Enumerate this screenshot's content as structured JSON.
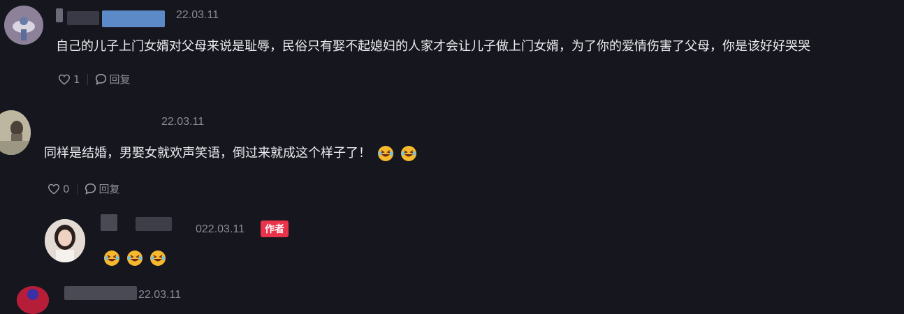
{
  "comments": [
    {
      "timestamp": "22.03.11",
      "text": "自己的儿子上门女婿对父母来说是耻辱，民俗只有娶不起媳妇的人家才会让儿子做上门女婿，为了你的爱情伤害了父母，你是该好好哭哭",
      "like_count": "1",
      "reply_label": "回复"
    },
    {
      "timestamp": "22.03.11",
      "text": "同样是结婚，男娶女就欢声笑语，倒过来就成这个样子了！",
      "like_count": "0",
      "reply_label": "回复"
    }
  ],
  "reply": {
    "timestamp": "022.03.11",
    "author_badge": "作者"
  },
  "partial": {
    "timestamp": "22.03.11"
  },
  "colors": {
    "background": "#16161e",
    "badge": "#e8334a"
  }
}
